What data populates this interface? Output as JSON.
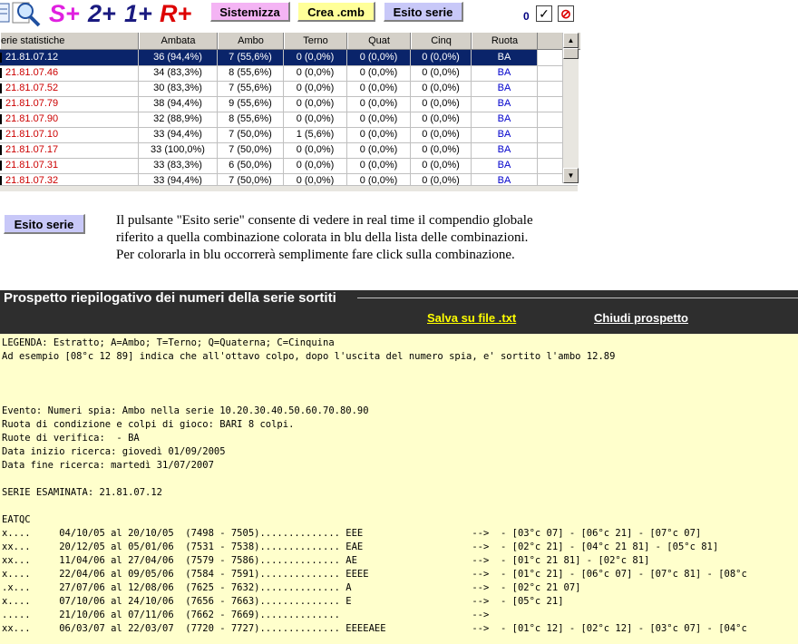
{
  "toolbar": {
    "big_buttons": [
      "S+",
      "2+",
      "1+",
      "R+"
    ],
    "big_colors": [
      "#e020e0",
      "#1a1a80",
      "#1a1a80",
      "#dd0000"
    ],
    "buttons": [
      {
        "label": "Sistemizza",
        "bg": "#f4b4f4"
      },
      {
        "label": "Crea .cmb",
        "bg": "#ffff99"
      },
      {
        "label": "Esito serie",
        "bg": "#c8c8f8"
      }
    ],
    "counter": "0",
    "check_glyph": "✓",
    "stop_glyph": "⊘"
  },
  "grid": {
    "columns": [
      "erie statistiche",
      "Ambata",
      "Ambo",
      "Terno",
      "Quat",
      "Cinq",
      "Ruota"
    ],
    "rows": [
      {
        "name": "21.81.07.12",
        "ambata": "36 (94,4%)",
        "ambo": "7 (55,6%)",
        "terno": "0 (0,0%)",
        "quat": "0 (0,0%)",
        "cinq": "0 (0,0%)",
        "ruota": "BA"
      },
      {
        "name": "21.81.07.46",
        "ambata": "34 (83,3%)",
        "ambo": "8 (55,6%)",
        "terno": "0 (0,0%)",
        "quat": "0 (0,0%)",
        "cinq": "0 (0,0%)",
        "ruota": "BA"
      },
      {
        "name": "21.81.07.52",
        "ambata": "30 (83,3%)",
        "ambo": "7 (55,6%)",
        "terno": "0 (0,0%)",
        "quat": "0 (0,0%)",
        "cinq": "0 (0,0%)",
        "ruota": "BA"
      },
      {
        "name": "21.81.07.79",
        "ambata": "38 (94,4%)",
        "ambo": "9 (55,6%)",
        "terno": "0 (0,0%)",
        "quat": "0 (0,0%)",
        "cinq": "0 (0,0%)",
        "ruota": "BA"
      },
      {
        "name": "21.81.07.90",
        "ambata": "32 (88,9%)",
        "ambo": "8 (55,6%)",
        "terno": "0 (0,0%)",
        "quat": "0 (0,0%)",
        "cinq": "0 (0,0%)",
        "ruota": "BA"
      },
      {
        "name": "21.81.07.10",
        "ambata": "33 (94,4%)",
        "ambo": "7 (50,0%)",
        "terno": "1 (5,6%)",
        "quat": "0 (0,0%)",
        "cinq": "0 (0,0%)",
        "ruota": "BA"
      },
      {
        "name": "21.81.07.17",
        "ambata": "33 (100,0%)",
        "ambo": "7 (50,0%)",
        "terno": "0 (0,0%)",
        "quat": "0 (0,0%)",
        "cinq": "0 (0,0%)",
        "ruota": "BA"
      },
      {
        "name": "21.81.07.31",
        "ambata": "33 (83,3%)",
        "ambo": "6 (50,0%)",
        "terno": "0 (0,0%)",
        "quat": "0 (0,0%)",
        "cinq": "0 (0,0%)",
        "ruota": "BA"
      },
      {
        "name": "21.81.07.32",
        "ambata": "33 (94,4%)",
        "ambo": "7 (50,0%)",
        "terno": "0 (0,0%)",
        "quat": "0 (0,0%)",
        "cinq": "0 (0,0%)",
        "ruota": "BA"
      }
    ]
  },
  "sample_button": {
    "label": "Esito serie"
  },
  "description": "Il pulsante \"Esito serie\" consente di vedere in real time il compendio globale riferito a quella combinazione colorata in blu della lista delle combinazioni.\nPer colorarla in blu occorrerà semplimente fare click sulla combinazione.",
  "report": {
    "title": "Prospetto riepilogativo dei numeri della serie sortiti",
    "save_link": "Salva su file .txt",
    "close_link": "Chiudi prospetto",
    "lines": [
      "LEGENDA: Estratto; A=Ambo; T=Terno; Q=Quaterna; C=Cinquina",
      "Ad esempio [08°c 12 89] indica che all'ottavo colpo, dopo l'uscita del numero spia, e' sortito l'ambo 12.89",
      "",
      "",
      "",
      "Evento: Numeri spia: Ambo nella serie 10.20.30.40.50.60.70.80.90",
      "Ruota di condizione e colpi di gioco: BARI 8 colpi.",
      "Ruote di verifica:  - BA",
      "Data inizio ricerca: giovedì 01/09/2005",
      "Data fine ricerca: martedì 31/07/2007",
      "",
      "SERIE ESAMINATA: 21.81.07.12",
      "",
      "EATQC",
      "x....     04/10/05 al 20/10/05  (7498 - 7505).............. EEE                   -->  - [03°c 07] - [06°c 21] - [07°c 07]",
      "xx...     20/12/05 al 05/01/06  (7531 - 7538).............. EAE                   -->  - [02°c 21] - [04°c 21 81] - [05°c 81]",
      "xx...     11/04/06 al 27/04/06  (7579 - 7586).............. AE                    -->  - [01°c 21 81] - [02°c 81]",
      "x....     22/04/06 al 09/05/06  (7584 - 7591).............. EEEE                  -->  - [01°c 21] - [06°c 07] - [07°c 81] - [08°c",
      ".x...     27/07/06 al 12/08/06  (7625 - 7632).............. A                     -->  - [02°c 21 07]",
      "x....     07/10/06 al 24/10/06  (7656 - 7663).............. E                     -->  - [05°c 21]",
      ".....     21/10/06 al 07/11/06  (7662 - 7669)..............                       -->",
      "xx...     06/03/07 al 22/03/07  (7720 - 7727).............. EEEEAEE               -->  - [01°c 12] - [02°c 12] - [03°c 07] - [04°c"
    ]
  }
}
